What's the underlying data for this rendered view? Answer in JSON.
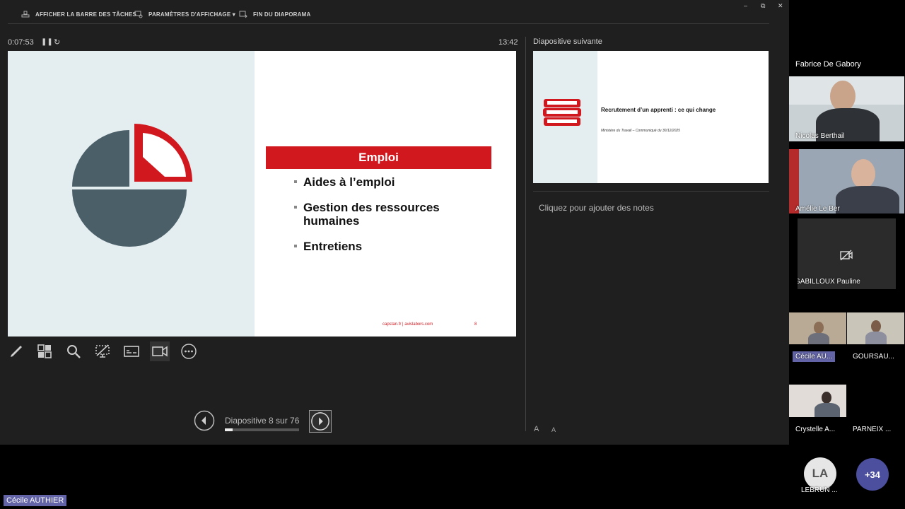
{
  "toolbar": {
    "show_taskbar": "AFFICHER LA BARRE DES TÂCHES",
    "display_settings": "PARAMÈTRES D'AFFICHAGE ▾",
    "end_slideshow": "FIN DU DIAPORAMA"
  },
  "window_controls": {
    "minimize": "–",
    "restore": "⧉",
    "close": "✕"
  },
  "timer": {
    "elapsed": "0:07:53",
    "clock": "13:42"
  },
  "current_slide": {
    "title": "Emploi",
    "bullets": [
      "Aides à l’emploi",
      "Gestion des ressources humaines",
      "Entretiens"
    ],
    "footer": "capstan.fr  |  avislabors.com",
    "footer_number": "8",
    "colors": {
      "accent": "#d2181f",
      "pie": "#4b5f69",
      "bg_panel": "#e4eef0"
    }
  },
  "tools": [
    "pen-icon",
    "slides-grid-icon",
    "zoom-icon",
    "black-screen-icon",
    "subtitles-icon",
    "camera-icon",
    "more-options-icon"
  ],
  "navigation": {
    "counter": "Diapositive 8 sur 76",
    "progress": 0.105
  },
  "next_slide": {
    "heading": "Diapositive suivante",
    "title": "Recrutement d’un apprenti : ce qui change",
    "subtitle": "Ministère du Travail – Communiqué du 30/12/2025"
  },
  "notes": {
    "placeholder": "Cliquez pour ajouter des notes",
    "increase_font": "A",
    "decrease_font": "A"
  },
  "participants": {
    "speaker": "Fabrice De Gabory",
    "tiles": [
      {
        "name": "Nicolas Berthail"
      },
      {
        "name": "Amélie Le Ber"
      },
      {
        "name": "GABILLOUX Pauline"
      },
      {
        "name": "Cécile AU..."
      },
      {
        "name": "GOURSAU..."
      },
      {
        "name": "Crystelle A..."
      },
      {
        "name": "PARNEIX ..."
      },
      {
        "name": "LEBRUN ...",
        "initials": "LA"
      }
    ],
    "overflow_count": "+34"
  },
  "self_label": "Cécile AUTHIER"
}
